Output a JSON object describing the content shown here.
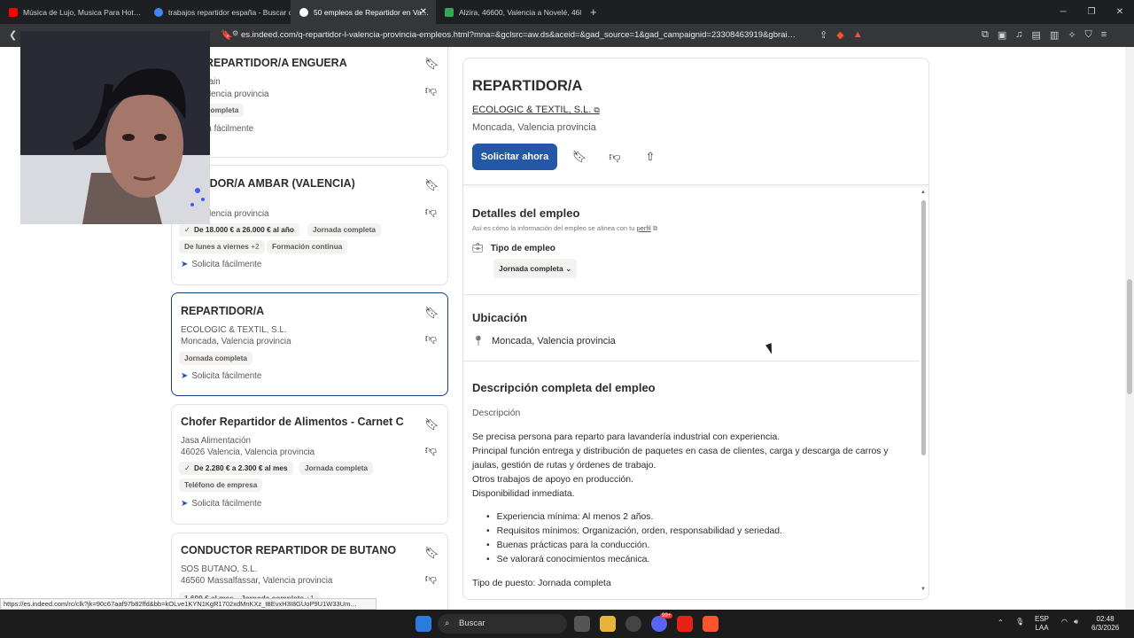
{
  "browser": {
    "tabs": [
      {
        "label": "Música de Lujo, Musica Para Hot…",
        "color": "#ff0000"
      },
      {
        "label": "trabajos repartidor españa - Buscar c…",
        "color": "#4285f4"
      },
      {
        "label": "50 empleos de Repartidor en Va…",
        "color": "#ffffff",
        "active": true
      },
      {
        "label": "Alzira, 46600, Valencia a Novelé, 468…",
        "color": "#34a853"
      }
    ],
    "url": "es.indeed.com/q-repartidor-l-valencia-provincia-empleos.html?mna=&gclsrc=aw.ds&aceid=&gad_source=1&gad_campaignid=23308463919&gbrai…",
    "status_url": "https://es.indeed.com/rc/clk?jk=90c67aaf97b82ffd&bb=kOLve1KYN1KgR1702xdMnKXz_t8EvxH3I8GUoP9U1W33Um…",
    "new_tab": "+"
  },
  "list": [
    {
      "title": "…/A REPARTIDOR/A ENGUERA",
      "company": "…N Spain",
      "location": "…a, Valencia provincia",
      "chips": [
        "…ada completa"
      ],
      "easy": "…olicita fácilmente"
    },
    {
      "title": "…RTIDOR/A AMBAR (VALENCIA)",
      "company": "",
      "location": "…a, Valencia provincia",
      "chips": [
        "De 18.000 € a 26.000 € al año",
        "Jornada completa",
        "De lunes a viernes",
        "+2",
        "Formación continua"
      ],
      "easy": "Solicita fácilmente"
    },
    {
      "title": "REPARTIDOR/A",
      "company": "ECOLOGIC & TEXTIL, S.L.",
      "location": "Moncada, Valencia provincia",
      "chips": [
        "Jornada completa"
      ],
      "easy": "Solicita fácilmente"
    },
    {
      "title": "Chofer Repartidor de Alimentos - Carnet C",
      "company": "Jasa Alimentación",
      "location": "46026 Valencia, Valencia provincia",
      "chips": [
        "De 2.280 € a 2.300 € al mes",
        "Jornada completa",
        "Teléfono de empresa"
      ],
      "easy": "Solicita fácilmente"
    },
    {
      "title": "CONDUCTOR REPARTIDOR DE BUTANO",
      "company": "SOS BUTANO, S.L.",
      "location": "46560 Massalfassar, Valencia provincia",
      "chips": [
        "1.600 € al mes",
        "Jornada completa",
        "+1"
      ],
      "easy": ""
    }
  ],
  "detail": {
    "title": "REPARTIDOR/A",
    "company": "ECOLOGIC & TEXTIL, S.L.",
    "location": "Moncada, Valencia provincia",
    "apply_label": "Solicitar ahora",
    "details_heading": "Detalles del empleo",
    "details_note": "Así es cómo la información del empleo se alinea con tu",
    "details_note_link": "perfil",
    "job_type_label": "Tipo de empleo",
    "job_type_value": "Jornada completa",
    "location_heading": "Ubicación",
    "location_value": "Moncada, Valencia provincia",
    "full_desc_heading": "Descripción completa del empleo",
    "desc_label": "Descripción",
    "desc_lines": [
      "Se precisa persona para reparto para lavandería industrial con experiencia.",
      "Principal función entrega y distribución de paquetes en casa de clientes, carga y descarga de carros y",
      "jaulas, gestión de rutas y órdenes de trabajo.",
      "Otros trabajos de apoyo en producción.",
      "Disponibilidad inmediata."
    ],
    "bullets": [
      "Experiencia mínima: Al menos 2 años.",
      "Requisitos mínimos: Organización, orden, responsabilidad y seriedad.",
      "Buenas prácticas para la conducción.",
      "Se valorará conocimientos mecánica."
    ],
    "job_type_line": "Tipo de puesto: Jornada completa"
  },
  "taskbar": {
    "search": "Buscar",
    "lang1": "ESP",
    "lang2": "LAA",
    "time": "02:48",
    "date": "6/3/2026",
    "badge": "99+"
  }
}
